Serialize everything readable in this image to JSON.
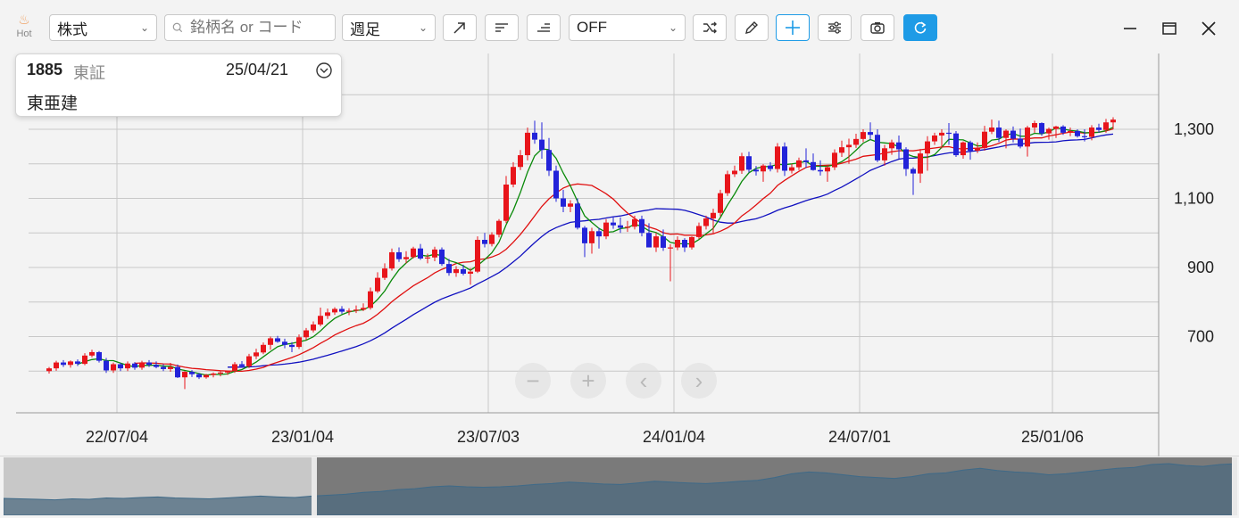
{
  "toolbar": {
    "hot_label": "Hot",
    "asset_type": "株式",
    "search_placeholder": "銘柄名 or コード",
    "period": "週足",
    "indicator": "OFF"
  },
  "info": {
    "code": "1885",
    "market": "東証",
    "date": "25/04/21",
    "name": "東亜建"
  },
  "colors": {
    "up": "#e8151b",
    "down": "#2323d9",
    "ma_short": "#0a8a0a",
    "ma_mid": "#e01010",
    "ma_long": "#1010c0",
    "grid": "#c8c8c8",
    "accent": "#1e9be6"
  },
  "chart_data": {
    "type": "candlestick",
    "y_ticks": [
      700,
      900,
      1100,
      1300
    ],
    "x_ticks": [
      {
        "label": "22/07/04",
        "index": 5
      },
      {
        "label": "23/01/04",
        "index": 31
      },
      {
        "label": "23/07/03",
        "index": 57
      },
      {
        "label": "24/01/04",
        "index": 83
      },
      {
        "label": "24/07/01",
        "index": 109
      },
      {
        "label": "25/01/06",
        "index": 136
      }
    ],
    "ohlc": [
      [
        600,
        612,
        593,
        608
      ],
      [
        608,
        630,
        601,
        625
      ],
      [
        625,
        632,
        612,
        618
      ],
      [
        618,
        631,
        610,
        628
      ],
      [
        628,
        634,
        615,
        621
      ],
      [
        621,
        652,
        617,
        645
      ],
      [
        645,
        662,
        640,
        655
      ],
      [
        655,
        658,
        625,
        630
      ],
      [
        630,
        638,
        595,
        602
      ],
      [
        602,
        625,
        595,
        620
      ],
      [
        620,
        624,
        600,
        608
      ],
      [
        608,
        628,
        600,
        622
      ],
      [
        622,
        626,
        604,
        610
      ],
      [
        610,
        630,
        604,
        625
      ],
      [
        625,
        632,
        612,
        618
      ],
      [
        618,
        628,
        608,
        612
      ],
      [
        612,
        620,
        600,
        606
      ],
      [
        606,
        624,
        598,
        612
      ],
      [
        612,
        619,
        580,
        582
      ],
      [
        582,
        600,
        548,
        598
      ],
      [
        598,
        603,
        583,
        591
      ],
      [
        591,
        595,
        577,
        582
      ],
      [
        582,
        592,
        578,
        589
      ],
      [
        589,
        596,
        582,
        593
      ],
      [
        593,
        602,
        585,
        596
      ],
      [
        596,
        602,
        589,
        600
      ],
      [
        600,
        626,
        595,
        620
      ],
      [
        620,
        629,
        611,
        614
      ],
      [
        614,
        650,
        609,
        643
      ],
      [
        643,
        665,
        635,
        654
      ],
      [
        654,
        683,
        649,
        676
      ],
      [
        676,
        700,
        662,
        695
      ],
      [
        695,
        702,
        682,
        685
      ],
      [
        685,
        694,
        666,
        676
      ],
      [
        676,
        684,
        655,
        670
      ],
      [
        670,
        706,
        664,
        698
      ],
      [
        698,
        725,
        690,
        718
      ],
      [
        718,
        744,
        712,
        735
      ],
      [
        735,
        784,
        730,
        760
      ],
      [
        760,
        781,
        751,
        770
      ],
      [
        770,
        785,
        763,
        780
      ],
      [
        780,
        788,
        766,
        772
      ],
      [
        772,
        782,
        762,
        775
      ],
      [
        775,
        790,
        768,
        778
      ],
      [
        778,
        796,
        774,
        783
      ],
      [
        783,
        842,
        778,
        831
      ],
      [
        831,
        886,
        826,
        870
      ],
      [
        870,
        912,
        864,
        897
      ],
      [
        897,
        955,
        891,
        944
      ],
      [
        944,
        958,
        916,
        924
      ],
      [
        924,
        947,
        912,
        930
      ],
      [
        930,
        960,
        926,
        955
      ],
      [
        955,
        968,
        922,
        926
      ],
      [
        926,
        940,
        912,
        929
      ],
      [
        929,
        960,
        918,
        952
      ],
      [
        952,
        958,
        905,
        910
      ],
      [
        910,
        925,
        876,
        884
      ],
      [
        884,
        904,
        873,
        895
      ],
      [
        895,
        908,
        877,
        882
      ],
      [
        882,
        898,
        850,
        888
      ],
      [
        888,
        990,
        884,
        980
      ],
      [
        980,
        1000,
        958,
        968
      ],
      [
        968,
        1002,
        961,
        995
      ],
      [
        995,
        1040,
        987,
        1035
      ],
      [
        1035,
        1165,
        1028,
        1140
      ],
      [
        1140,
        1205,
        1132,
        1191
      ],
      [
        1191,
        1240,
        1182,
        1225
      ],
      [
        1225,
        1305,
        1210,
        1290
      ],
      [
        1290,
        1325,
        1258,
        1270
      ],
      [
        1270,
        1320,
        1215,
        1240
      ],
      [
        1240,
        1275,
        1165,
        1180
      ],
      [
        1180,
        1195,
        1090,
        1100
      ],
      [
        1100,
        1125,
        1060,
        1076
      ],
      [
        1076,
        1095,
        1060,
        1085
      ],
      [
        1085,
        1100,
        1010,
        1015
      ],
      [
        1015,
        1020,
        930,
        970
      ],
      [
        970,
        1015,
        940,
        1005
      ],
      [
        1005,
        1015,
        955,
        990
      ],
      [
        990,
        1040,
        982,
        1030
      ],
      [
        1030,
        1048,
        1012,
        1022
      ],
      [
        1022,
        1045,
        1000,
        1015
      ],
      [
        1015,
        1035,
        1003,
        1018
      ],
      [
        1018,
        1050,
        1010,
        1040
      ],
      [
        1040,
        1050,
        990,
        1000
      ],
      [
        1000,
        1028,
        958,
        958
      ],
      [
        958,
        1000,
        945,
        990
      ],
      [
        990,
        1010,
        948,
        957
      ],
      [
        957,
        967,
        860,
        958
      ],
      [
        958,
        990,
        950,
        980
      ],
      [
        980,
        985,
        945,
        958
      ],
      [
        958,
        990,
        952,
        988
      ],
      [
        988,
        1030,
        982,
        1020
      ],
      [
        1020,
        1050,
        1010,
        1042
      ],
      [
        1042,
        1070,
        1000,
        1058
      ],
      [
        1058,
        1125,
        1048,
        1115
      ],
      [
        1115,
        1180,
        1107,
        1170
      ],
      [
        1170,
        1195,
        1162,
        1180
      ],
      [
        1180,
        1232,
        1171,
        1222
      ],
      [
        1222,
        1235,
        1175,
        1183
      ],
      [
        1183,
        1194,
        1166,
        1178
      ],
      [
        1178,
        1199,
        1148,
        1195
      ],
      [
        1195,
        1205,
        1178,
        1185
      ],
      [
        1185,
        1260,
        1175,
        1250
      ],
      [
        1250,
        1262,
        1165,
        1180
      ],
      [
        1180,
        1200,
        1172,
        1190
      ],
      [
        1190,
        1218,
        1182,
        1210
      ],
      [
        1210,
        1245,
        1188,
        1205
      ],
      [
        1205,
        1230,
        1180,
        1182
      ],
      [
        1182,
        1210,
        1166,
        1178
      ],
      [
        1178,
        1195,
        1148,
        1190
      ],
      [
        1190,
        1242,
        1182,
        1232
      ],
      [
        1232,
        1267,
        1220,
        1248
      ],
      [
        1248,
        1273,
        1200,
        1255
      ],
      [
        1255,
        1287,
        1246,
        1272
      ],
      [
        1272,
        1300,
        1263,
        1292
      ],
      [
        1292,
        1320,
        1270,
        1284
      ],
      [
        1284,
        1300,
        1205,
        1210
      ],
      [
        1210,
        1255,
        1195,
        1245
      ],
      [
        1245,
        1270,
        1226,
        1262
      ],
      [
        1262,
        1282,
        1215,
        1242
      ],
      [
        1242,
        1248,
        1165,
        1185
      ],
      [
        1185,
        1190,
        1110,
        1172
      ],
      [
        1172,
        1243,
        1145,
        1230
      ],
      [
        1230,
        1280,
        1180,
        1265
      ],
      [
        1265,
        1290,
        1255,
        1282
      ],
      [
        1282,
        1300,
        1245,
        1290
      ],
      [
        1290,
        1318,
        1255,
        1288
      ],
      [
        1288,
        1295,
        1220,
        1225
      ],
      [
        1225,
        1265,
        1215,
        1262
      ],
      [
        1262,
        1267,
        1212,
        1238
      ],
      [
        1238,
        1262,
        1231,
        1246
      ],
      [
        1246,
        1310,
        1238,
        1293
      ],
      [
        1293,
        1328,
        1286,
        1305
      ],
      [
        1305,
        1325,
        1263,
        1275
      ],
      [
        1275,
        1300,
        1245,
        1296
      ],
      [
        1296,
        1308,
        1262,
        1273
      ],
      [
        1273,
        1302,
        1245,
        1250
      ],
      [
        1250,
        1310,
        1221,
        1305
      ],
      [
        1305,
        1325,
        1290,
        1318
      ],
      [
        1318,
        1320,
        1281,
        1288
      ],
      [
        1288,
        1305,
        1270,
        1301
      ],
      [
        1301,
        1310,
        1275,
        1308
      ],
      [
        1308,
        1312,
        1284,
        1290
      ],
      [
        1290,
        1305,
        1280,
        1295
      ],
      [
        1295,
        1300,
        1276,
        1280
      ],
      [
        1280,
        1300,
        1265,
        1278
      ],
      [
        1278,
        1312,
        1268,
        1305
      ],
      [
        1305,
        1316,
        1290,
        1298
      ],
      [
        1298,
        1330,
        1290,
        1320
      ],
      [
        1320,
        1335,
        1300,
        1328
      ]
    ]
  },
  "chart_figure": {
    "ohlc": [
      [
        598,
        607,
        593,
        603
      ],
      [
        603,
        628,
        600,
        623
      ],
      [
        623,
        633,
        615,
        627
      ],
      [
        627,
        631,
        618,
        625
      ],
      [
        625,
        632,
        616,
        620
      ],
      [
        620,
        642,
        616,
        636
      ],
      [
        636,
        662,
        631,
        655
      ],
      [
        655,
        660,
        632,
        640
      ],
      [
        640,
        643,
        605,
        610
      ],
      [
        610,
        622,
        600,
        618
      ],
      [
        618,
        624,
        604,
        608
      ],
      [
        608,
        626,
        602,
        620
      ],
      [
        620,
        624,
        603,
        609
      ],
      [
        609,
        628,
        605,
        622
      ],
      [
        622,
        632,
        612,
        618
      ],
      [
        618,
        627,
        609,
        611
      ],
      [
        611,
        619,
        602,
        604
      ],
      [
        604,
        621,
        600,
        612
      ],
      [
        612,
        616,
        583,
        585
      ],
      [
        585,
        602,
        553,
        598
      ],
      [
        598,
        603,
        583,
        589
      ],
      [
        589,
        594,
        578,
        581
      ],
      [
        581,
        590,
        578,
        587
      ],
      [
        587,
        594,
        582,
        592
      ],
      [
        592,
        599,
        586,
        596
      ],
      [
        596,
        601,
        590,
        599
      ],
      [
        599,
        622,
        595,
        617
      ],
      [
        617,
        628,
        612,
        615
      ],
      [
        615,
        648,
        611,
        641
      ],
      [
        641,
        662,
        637,
        652
      ],
      [
        652,
        680,
        648,
        673
      ],
      [
        673,
        698,
        664,
        692
      ],
      [
        692,
        701,
        684,
        686
      ],
      [
        686,
        692,
        668,
        675
      ],
      [
        675,
        683,
        657,
        669
      ],
      [
        669,
        704,
        665,
        697
      ],
      [
        697,
        722,
        690,
        716
      ],
      [
        716,
        742,
        711,
        734
      ],
      [
        734,
        780,
        730,
        758
      ],
      [
        758,
        780,
        752,
        770
      ],
      [
        770,
        784,
        764,
        778
      ],
      [
        778,
        786,
        766,
        771
      ],
      [
        771,
        781,
        763,
        774
      ],
      [
        774,
        788,
        768,
        777
      ],
      [
        777,
        795,
        773,
        782
      ],
      [
        782,
        840,
        777,
        829
      ],
      [
        829,
        883,
        825,
        867
      ],
      [
        867,
        908,
        862,
        895
      ],
      [
        895,
        952,
        890,
        940
      ],
      [
        940,
        957,
        914,
        922
      ]
    ]
  },
  "overview": {
    "window_start_label": "",
    "values": [
      0.25,
      0.24,
      0.23,
      0.22,
      0.24,
      0.23,
      0.26,
      0.25,
      0.27,
      0.28,
      0.26,
      0.25,
      0.24,
      0.26,
      0.28,
      0.3,
      0.28,
      0.27,
      0.3,
      0.32,
      0.34,
      0.38,
      0.4,
      0.44,
      0.46,
      0.5,
      0.52,
      0.5,
      0.49,
      0.5,
      0.52,
      0.55,
      0.57,
      0.6,
      0.58,
      0.56,
      0.55,
      0.58,
      0.62,
      0.6,
      0.58,
      0.57,
      0.59,
      0.62,
      0.64,
      0.7,
      0.78,
      0.82,
      0.8,
      0.76,
      0.72,
      0.7,
      0.68,
      0.72,
      0.78,
      0.8,
      0.86,
      0.9,
      0.85,
      0.82,
      0.8,
      0.76,
      0.78,
      0.82,
      0.86,
      0.9,
      0.92,
      0.98,
      1.0,
      0.96,
      0.94,
      0.98,
      1.0
    ]
  }
}
